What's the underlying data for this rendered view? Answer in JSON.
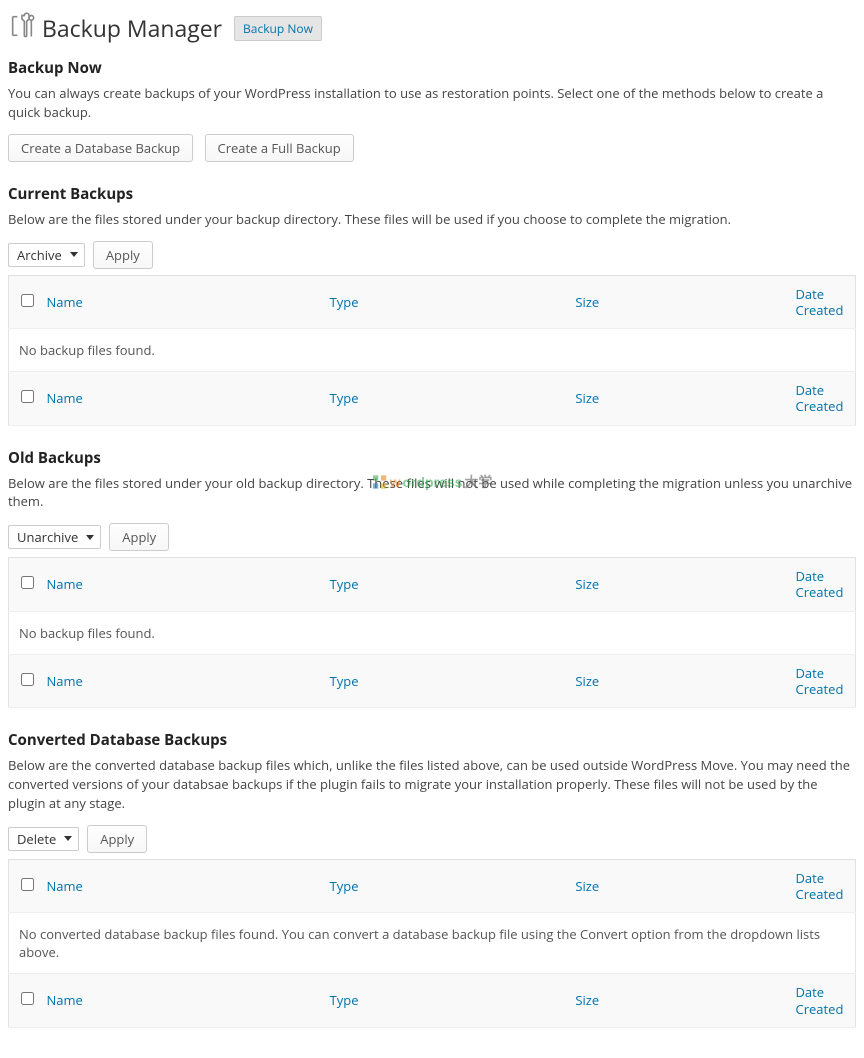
{
  "header": {
    "title": "Backup Manager",
    "button": "Backup Now"
  },
  "table_cols": {
    "name": "Name",
    "type": "Type",
    "size": "Size",
    "date_created_1": "Date",
    "date_created_2": "Created"
  },
  "backup_now": {
    "title": "Backup Now",
    "intro": "You can always create backups of your WordPress installation to use as restoration points. Select one of the methods below to create a quick backup.",
    "btn_db": "Create a Database Backup",
    "btn_full": "Create a Full Backup"
  },
  "current": {
    "title": "Current Backups",
    "intro": "Below are the files stored under your backup directory. These files will be used if you choose to complete the migration.",
    "action": "Archive",
    "apply": "Apply",
    "empty": "No backup files found."
  },
  "old": {
    "title": "Old Backups",
    "intro": "Below are the files stored under your old backup directory. These files will not be used while completing the migration unless you unarchive them.",
    "action": "Unarchive",
    "apply": "Apply",
    "empty": "No backup files found."
  },
  "converted": {
    "title": "Converted Database Backups",
    "intro": "Below are the converted database backup files which, unlike the files listed above, can be used outside WordPress Move. You may need the converted versions of your databsae backups if the plugin fails to migrate your installation properly. These files will not be used by the plugin at any stage.",
    "action": "Delete",
    "apply": "Apply",
    "empty": "No converted database backup files found. You can convert a database backup file using the Convert option from the dropdown lists above."
  },
  "watermark": {
    "t1": "w",
    "t2": "ordpress",
    "t3": "大学"
  }
}
